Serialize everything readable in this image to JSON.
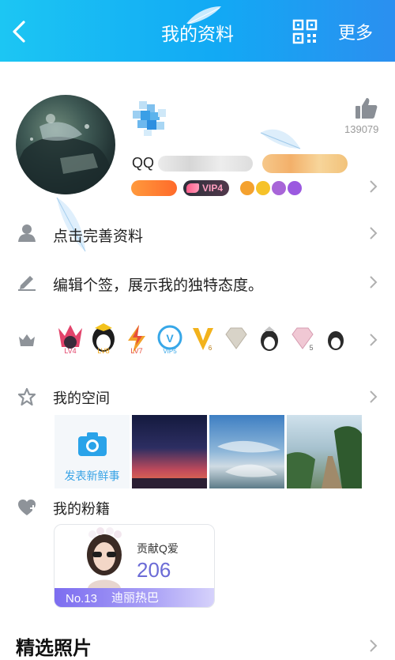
{
  "header": {
    "title": "我的资料",
    "more_label": "更多"
  },
  "profile": {
    "like_count": "139079",
    "qq_label": "QQ",
    "vip_badge": "VIP4"
  },
  "rows": {
    "complete_profile": "点击完善资料",
    "signature": "编辑个签，展示我的独特态度。"
  },
  "levels": [
    {
      "icon": "lv4-crown-icon",
      "label": "LV4"
    },
    {
      "icon": "lv8-penguin-icon",
      "label": "LV8"
    },
    {
      "icon": "lv7-lightning-icon",
      "label": "LV7"
    },
    {
      "icon": "vip-badge-icon",
      "label": "VIP5"
    },
    {
      "icon": "v-badge-icon",
      "label": "6"
    },
    {
      "icon": "diamond-icon",
      "label": ""
    },
    {
      "icon": "penguin-icon",
      "label": ""
    },
    {
      "icon": "gem-icon",
      "label": "5"
    },
    {
      "icon": "penguin-small-icon",
      "label": ""
    }
  ],
  "space": {
    "title": "我的空间",
    "post_label": "发表新鲜事",
    "photos": [
      "sunset-photo",
      "sky-sea-photo",
      "forest-path-photo"
    ]
  },
  "fans": {
    "title": "我的粉籍",
    "contrib_label": "贡献Q爱",
    "contrib_value": "206",
    "rank": "No.13",
    "name": "迪丽热巴"
  },
  "featured": {
    "title": "精选照片"
  },
  "colors": {
    "header_start": "#1cc6f3",
    "header_end": "#2b8ff0",
    "accent": "#3aa4e6",
    "fan_purple": "#7c6df0"
  }
}
